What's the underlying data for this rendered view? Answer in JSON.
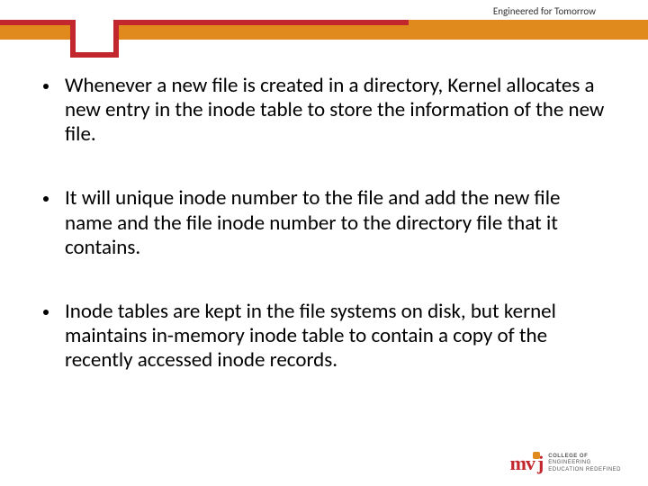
{
  "header": {
    "tagline": "Engineered for Tomorrow"
  },
  "bullets": [
    "Whenever a new file is created in a directory, Kernel allocates a new entry in the inode table to store the information of the new file.",
    "It will unique inode number to the file and add the new file name and the file inode number to the directory file that it contains.",
    "Inode tables are kept in the file systems on disk, but kernel maintains in-memory inode table to contain a copy of the recently accessed inode records."
  ],
  "logo": {
    "mark_left": "m",
    "mark_right": "v",
    "mark_j": "j",
    "line1": "COLLEGE OF",
    "line2": "ENGINEERING",
    "line3": "EDUCATION REDEFINED"
  }
}
